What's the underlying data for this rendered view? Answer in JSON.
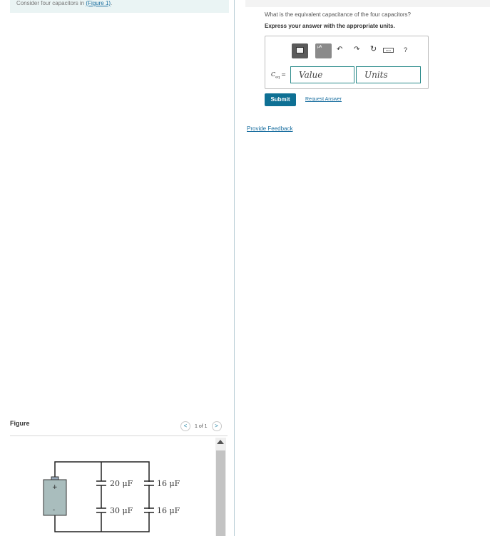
{
  "intro": {
    "text": "Consider four capacitors in ",
    "link": "(Figure 1)",
    "after": "."
  },
  "figure": {
    "label": "Figure",
    "pager": {
      "prev": "<",
      "position": "1 of 1",
      "next": ">"
    },
    "circuit": {
      "battery_plus": "+",
      "battery_minus": "-",
      "cap_top_left": "20 μF",
      "cap_bottom_left": "30 μF",
      "cap_top_right": "16 μF",
      "cap_bottom_right": "16 μF"
    }
  },
  "question": {
    "prompt": "What is the equivalent capacitance of the four capacitors?",
    "instruction": "Express your answer with the appropriate units."
  },
  "toolbar": {
    "units_button_label": "μA",
    "undo": "↶",
    "redo": "↷",
    "reset": "↻",
    "keyboard": "▭▭",
    "help": "?"
  },
  "answer": {
    "symbol": "C",
    "subscript": "eq",
    "equals": "=",
    "value_placeholder": "Value",
    "units_placeholder": "Units"
  },
  "actions": {
    "submit": "Submit",
    "request_answer": "Request Answer",
    "provide_feedback": "Provide Feedback"
  }
}
